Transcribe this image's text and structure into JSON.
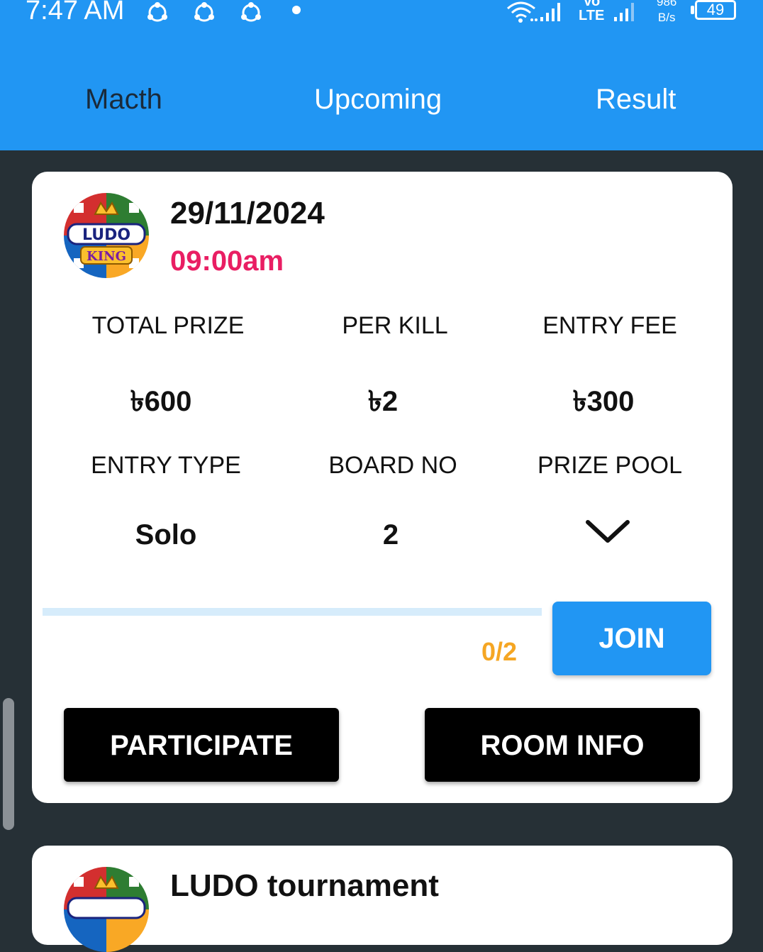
{
  "status_bar": {
    "time": "7:47 AM",
    "volte_top": "Vo",
    "volte_bottom": "LTE",
    "speed_value": "986",
    "speed_unit": "B/s",
    "battery": "49"
  },
  "tabs": [
    {
      "label": "Macth",
      "active": true
    },
    {
      "label": "Upcoming",
      "active": false
    },
    {
      "label": "Result",
      "active": false
    }
  ],
  "match_card": {
    "logo_text_top": "LUDO",
    "logo_text_bottom": "KING",
    "date": "29/11/2024",
    "time": "09:00am",
    "stats": [
      {
        "label": "TOTAL PRIZE",
        "value": "৳600"
      },
      {
        "label": "PER KILL",
        "value": "৳2"
      },
      {
        "label": "ENTRY FEE",
        "value": "৳300"
      },
      {
        "label": "ENTRY TYPE",
        "value": "Solo"
      },
      {
        "label": "BOARD NO",
        "value": "2"
      },
      {
        "label": "PRIZE POOL",
        "value_icon": "chevron-down-icon"
      }
    ],
    "progress": {
      "joined": 0,
      "total": 2,
      "fraction": 0.0
    },
    "count_label": "0/2",
    "join_label": "JOIN",
    "participate_label": "PARTICIPATE",
    "room_info_label": "ROOM INFO"
  },
  "next_card": {
    "title": "LUDO tournament"
  },
  "colors": {
    "accent": "#2196F3",
    "time": "#E91E63",
    "count": "#F5A623",
    "background": "#263036"
  }
}
